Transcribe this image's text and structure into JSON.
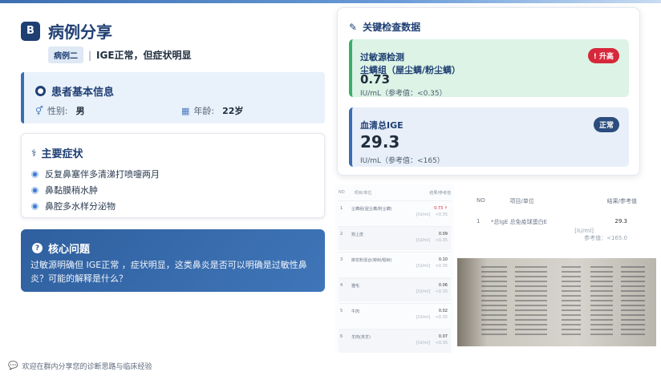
{
  "header": {
    "title": "病例分享",
    "title_icon": "B"
  },
  "case": {
    "tag": "病例二",
    "separator": "|",
    "description": "IGE正常，但症状明显"
  },
  "patient": {
    "heading": "患者基本信息",
    "gender_label": "性别:",
    "gender_value": "男",
    "age_label": "年龄:",
    "age_value": "22岁"
  },
  "symptoms": {
    "heading": "主要症状",
    "items": [
      "反复鼻塞伴多清涕打喷嚏两月",
      "鼻黏膜稍水肿",
      "鼻腔多水样分泌物"
    ]
  },
  "core": {
    "heading": "核心问题",
    "text": "过敏源明确但 IGE正常 ，症状明显，这类鼻炎是否可以明确是过敏性鼻炎？可能的解释是什么？"
  },
  "key_data": {
    "heading": "关键检查数据",
    "cards": [
      {
        "title": "过敏源检测",
        "subtitle": "尘螨组（屋尘螨/粉尘螨）",
        "value": "0.73",
        "ref": "IU/mL（参考值：<0.35）",
        "badge": "! 升高",
        "badge_color": "#d7273a"
      },
      {
        "title": "血清总IGE",
        "value": "29.3",
        "ref": "IU/mL（参考值：<165）",
        "badge": "正常",
        "badge_color": "#2b4d7d"
      }
    ]
  },
  "report1": {
    "headers": [
      "NO",
      "项目/单位",
      "结果/参考值"
    ],
    "rows": [
      {
        "no": "1",
        "name": "尘螨组(屋尘螨/粉尘螨)",
        "value": "0.73 ↑",
        "unit": "[IU/ml]",
        "ref": "<0.35"
      },
      {
        "no": "2",
        "name": "狗上皮",
        "value": "0.09",
        "unit": "[IU/ml]",
        "ref": "<0.35"
      },
      {
        "no": "3",
        "name": "柳花粉混合(柳树/榆树)",
        "value": "0.10",
        "unit": "[IU/ml]",
        "ref": "<0.35"
      },
      {
        "no": "4",
        "name": "猫毛",
        "value": "0.06",
        "unit": "[IU/ml]",
        "ref": "<0.35"
      },
      {
        "no": "5",
        "name": "牛肉",
        "value": "0.02",
        "unit": "[IU/ml]",
        "ref": "<0.35"
      },
      {
        "no": "6",
        "name": "羊肉(羔羊)",
        "value": "0.07",
        "unit": "[IU/ml]",
        "ref": "<0.35"
      }
    ]
  },
  "report2": {
    "headers": [
      "NO",
      "项目/单位",
      "结果/参考值"
    ],
    "no": "1",
    "name": "*总IgE 总免疫球蛋白E",
    "value": "29.3",
    "unit": "[IU/ml]",
    "ref": "参考值：<165.0"
  },
  "footer": {
    "text": "欢迎在群内分享您的诊断思路与临床经验"
  }
}
